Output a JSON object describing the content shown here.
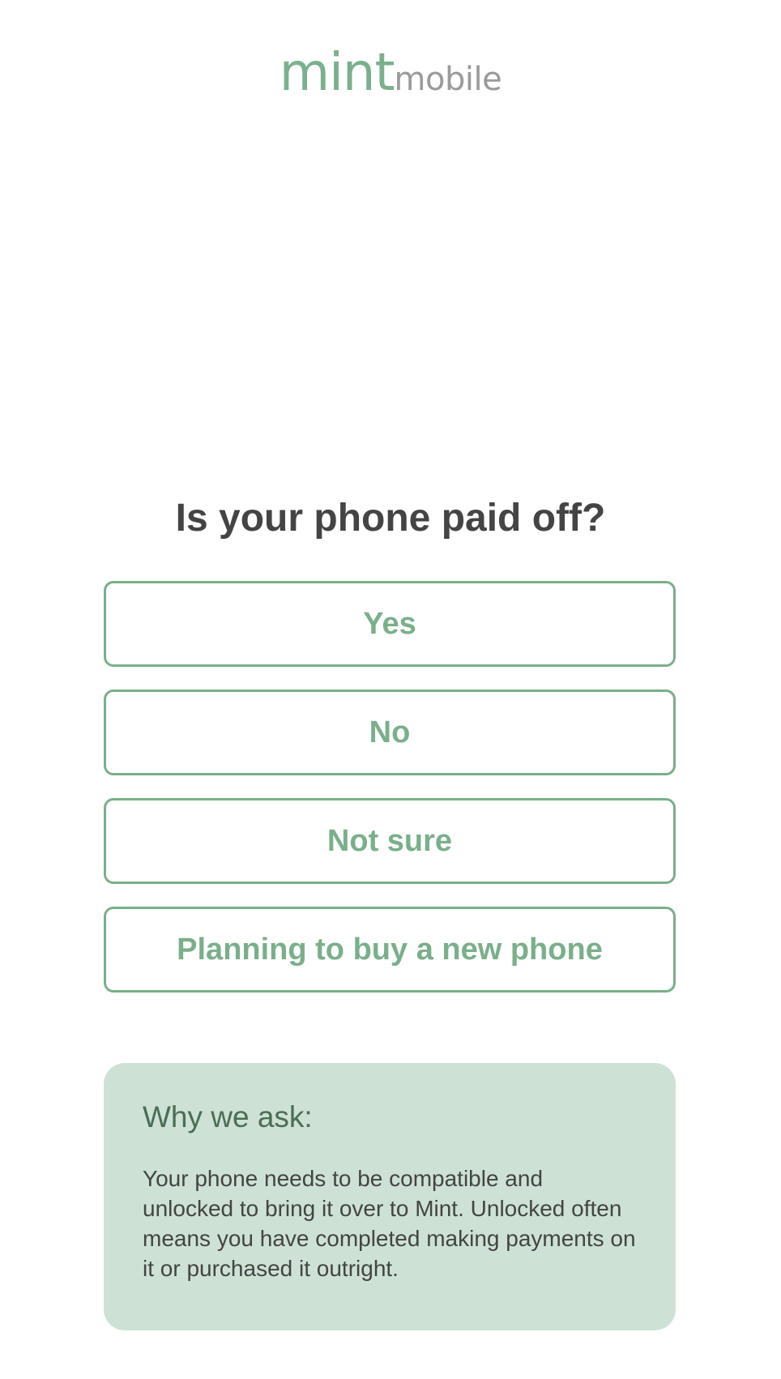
{
  "brand": {
    "logo_primary": "mint",
    "logo_secondary": "mobile",
    "primary_color": "#7aaf8a",
    "secondary_color": "#9a9a9a"
  },
  "question": {
    "title": "Is your phone paid off?"
  },
  "answers": [
    {
      "label": "Yes"
    },
    {
      "label": "No"
    },
    {
      "label": "Not sure"
    },
    {
      "label": "Planning to buy a new phone"
    }
  ],
  "info": {
    "heading": "Why we ask:",
    "body": "Your phone needs to be compatible and unlocked to bring it over to Mint. Unlocked often means you have completed making payments on it or purchased it outright.",
    "background_color": "#cde2d4"
  }
}
